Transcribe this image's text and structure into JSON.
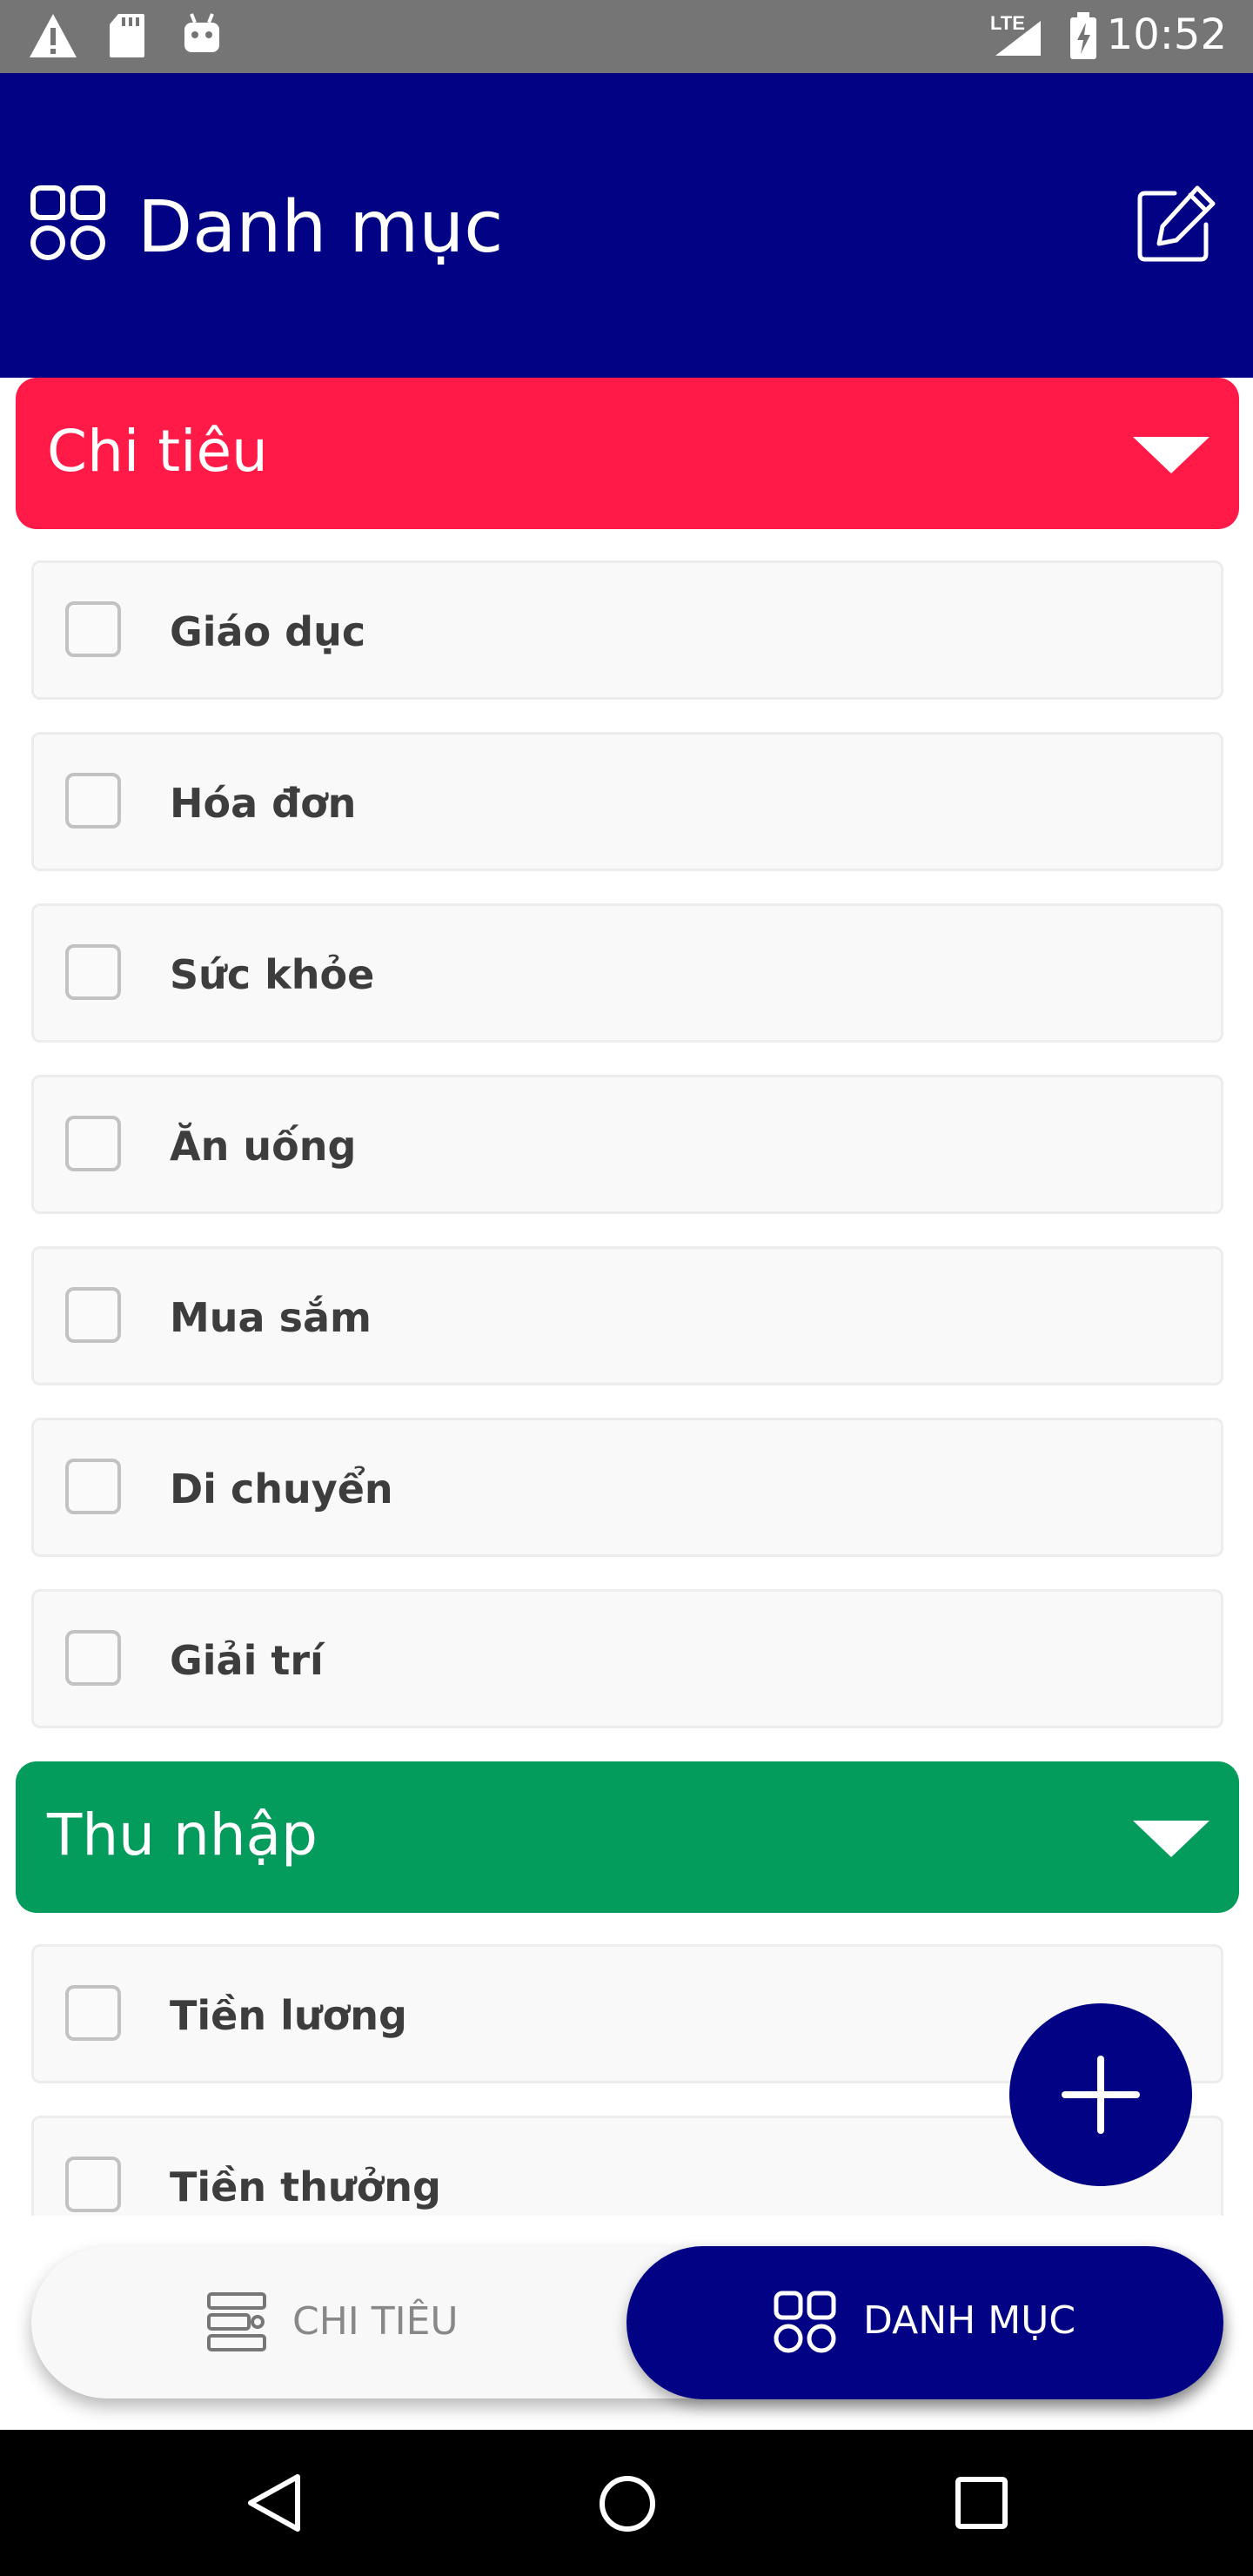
{
  "status_bar": {
    "time": "10:52",
    "network": "LTE",
    "icons": [
      "alert-icon",
      "sd-card-icon",
      "android-icon",
      "signal-icon",
      "battery-charging-icon"
    ]
  },
  "app_bar": {
    "title": "Danh mục",
    "leading_icon": "grid-icon",
    "trailing_icon": "edit-icon"
  },
  "sections": [
    {
      "title": "Chi tiêu",
      "color": "#FF1A48",
      "items": [
        "Giáo dục",
        "Hóa đơn",
        "Sức khỏe",
        "Ăn uống",
        "Mua sắm",
        "Di chuyển",
        "Giải trí"
      ]
    },
    {
      "title": "Thu nhập",
      "color": "#049C5C",
      "items": [
        "Tiền lương",
        "Tiền thưởng"
      ]
    }
  ],
  "fab": {
    "icon": "plus-icon"
  },
  "bottom_nav": {
    "tabs": [
      {
        "label": "CHI TIÊU",
        "icon": "list-icon",
        "active": false
      },
      {
        "label": "DANH MỤC",
        "icon": "grid-icon",
        "active": true
      }
    ]
  },
  "colors": {
    "primary": "#020285",
    "expense": "#FF1A48",
    "income": "#049C5C",
    "status_bar": "#757575"
  },
  "system_nav": {
    "icons": [
      "back-icon",
      "home-icon",
      "recents-icon"
    ]
  }
}
